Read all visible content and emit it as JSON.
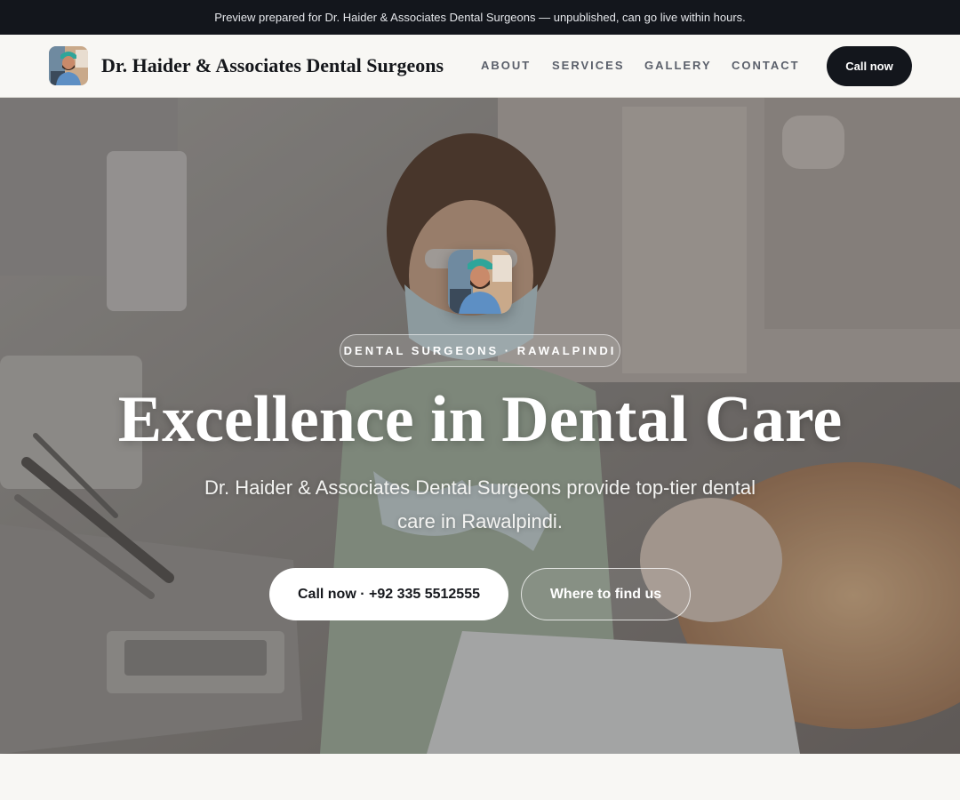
{
  "banner": {
    "text": "Preview prepared for Dr. Haider & Associates Dental Surgeons — unpublished, can go live within hours."
  },
  "header": {
    "brand_name": "Dr. Haider & Associates Dental Surgeons",
    "nav": [
      {
        "label": "ABOUT"
      },
      {
        "label": "SERVICES"
      },
      {
        "label": "GALLERY"
      },
      {
        "label": "CONTACT"
      }
    ],
    "call_label": "Call now"
  },
  "hero": {
    "badge": "DENTAL SURGEONS · RAWALPINDI",
    "title": "Excellence in Dental Care",
    "subtitle": "Dr. Haider & Associates Dental Surgeons provide top-tier dental care in Rawalpindi.",
    "primary_cta": "Call now · +92 335 5512555",
    "secondary_cta": "Where to find us"
  },
  "colors": {
    "dark": "#13161c",
    "page_bg": "#f8f7f4",
    "nav_text": "#5a5f6a",
    "white": "#ffffff"
  }
}
